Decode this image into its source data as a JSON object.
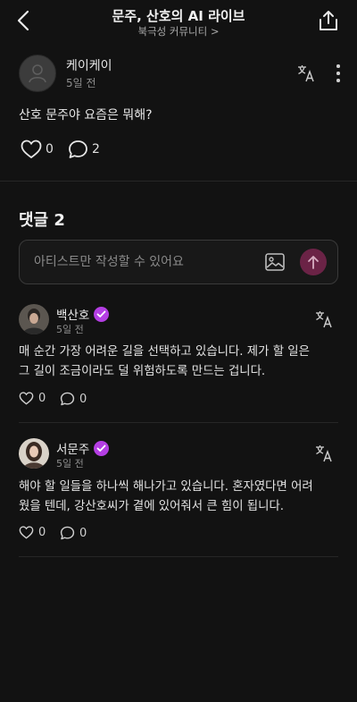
{
  "header": {
    "title": "문주, 산호의 AI 라이브",
    "subtitle": "북극성 커뮤니티 >"
  },
  "post": {
    "author": "케이케이",
    "time": "5일 전",
    "body": "산호 문주야 요즘은 뭐해?",
    "likes": "0",
    "comments": "2"
  },
  "comments_title": "댓글 2",
  "composer": {
    "placeholder": "아티스트만 작성할 수 있어요"
  },
  "comments": [
    {
      "author": "백산호",
      "time": "5일 전",
      "line1": "매 순간 가장 어려운 길을 선택하고 있습니다. 제가 할 일은",
      "line2": "그 길이 조금이라도 덜 위험하도록 만드는 겁니다.",
      "likes": "0",
      "replies": "0"
    },
    {
      "author": "서문주",
      "time": "5일 전",
      "line1": "해야 할 일들을 하나씩 해나가고 있습니다. 혼자였다면 어려",
      "line2": "웠을 텐데, 강산호씨가 곁에 있어줘서 큰 힘이 됩니다.",
      "likes": "0",
      "replies": "0"
    }
  ],
  "colors": {
    "background": "#121212",
    "send_button": "#6b2346",
    "verified_badge": "#b43ee3"
  }
}
